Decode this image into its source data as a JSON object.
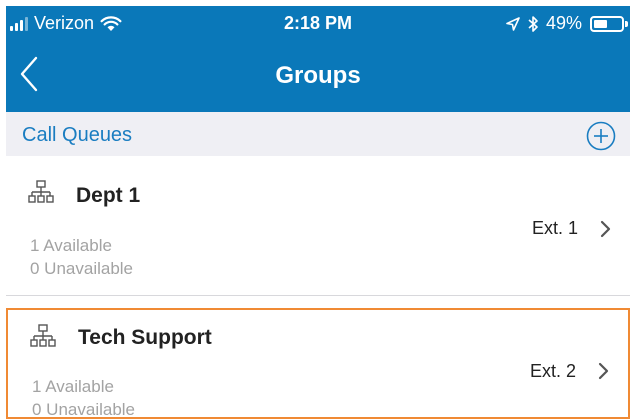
{
  "status_bar": {
    "carrier": "Verizon",
    "time": "2:18 PM",
    "battery_percent": "49%",
    "battery_level": 0.49
  },
  "nav": {
    "title": "Groups",
    "back_icon": "chevron-left-icon"
  },
  "section": {
    "title": "Call Queues",
    "add_icon": "plus-circle-icon"
  },
  "groups": [
    {
      "name": "Dept 1",
      "available": "1 Available",
      "unavailable": "0 Unavailable",
      "ext": "Ext. 1",
      "icon": "hierarchy-icon"
    },
    {
      "name": "Tech Support",
      "available": "1 Available",
      "unavailable": "0 Unavailable",
      "ext": "Ext. 2",
      "icon": "hierarchy-icon"
    }
  ],
  "colors": {
    "header_blue": "#0a78b9",
    "link_blue": "#1a7dc1",
    "highlight_orange": "#f08a34"
  }
}
